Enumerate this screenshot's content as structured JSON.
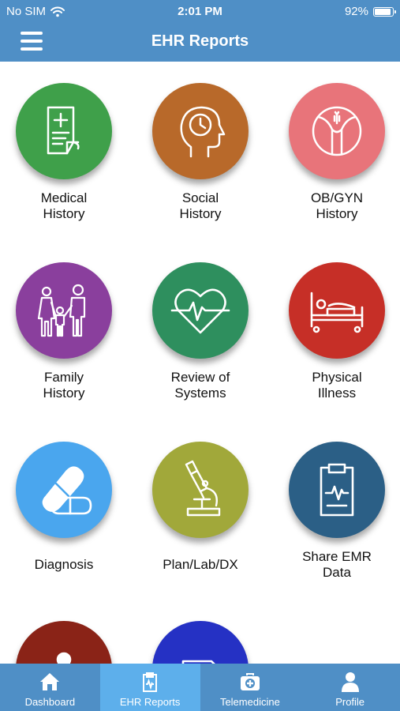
{
  "status_bar": {
    "carrier": "No SIM",
    "time": "2:01 PM",
    "battery": "92%",
    "battery_level": 0.92
  },
  "header": {
    "title": "EHR Reports"
  },
  "tiles": [
    {
      "label": "Medical\nHistory",
      "icon": "medical-document-icon",
      "color": "#3fa04a"
    },
    {
      "label": "Social\nHistory",
      "icon": "head-clock-icon",
      "color": "#b8692a"
    },
    {
      "label": "OB/GYN\nHistory",
      "icon": "uterus-icon",
      "color": "#e8747a"
    },
    {
      "label": "Family\nHistory",
      "icon": "family-icon",
      "color": "#8a3f9d"
    },
    {
      "label": "Review of\nSystems",
      "icon": "heart-pulse-icon",
      "color": "#2e8f5e"
    },
    {
      "label": "Physical\nIllness",
      "icon": "hospital-bed-icon",
      "color": "#c62f27"
    },
    {
      "label": "Diagnosis",
      "icon": "capsule-icon",
      "color": "#4aa6ee"
    },
    {
      "label": "Plan/Lab/DX",
      "icon": "microscope-icon",
      "color": "#a1a83a"
    },
    {
      "label": "Share EMR\nData",
      "icon": "clipboard-pulse-icon",
      "color": "#2b5f86"
    },
    {
      "label": "",
      "icon": "person-icon",
      "color": "#8a2317"
    },
    {
      "label": "",
      "icon": "document-icon",
      "color": "#2531c4"
    }
  ],
  "tabbar": {
    "active": "EHR Reports",
    "tabs": [
      {
        "label": "Dashboard",
        "icon": "home-icon"
      },
      {
        "label": "EHR Reports",
        "icon": "clipboard-icon"
      },
      {
        "label": "Telemedicine",
        "icon": "medical-kit-icon"
      },
      {
        "label": "Profile",
        "icon": "user-icon"
      }
    ]
  }
}
